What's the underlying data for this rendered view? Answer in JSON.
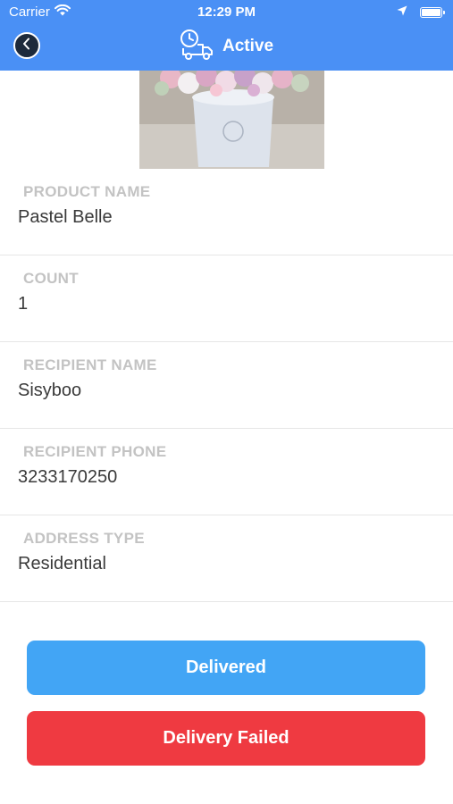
{
  "status_bar": {
    "carrier": "Carrier",
    "time": "12:29 PM"
  },
  "header": {
    "title": "Active",
    "back_icon": "chevron-left-icon",
    "title_icon": "delivery-truck-clock-icon",
    "background_color": "#4a90f5"
  },
  "fields": [
    {
      "label": "PRODUCT NAME",
      "value": "Pastel Belle"
    },
    {
      "label": "COUNT",
      "value": "1"
    },
    {
      "label": "RECIPIENT NAME",
      "value": "Sisyboo"
    },
    {
      "label": "RECIPIENT PHONE",
      "value": "3233170250"
    },
    {
      "label": "ADDRESS TYPE",
      "value": "Residential"
    }
  ],
  "actions": {
    "delivered_label": "Delivered",
    "delivered_color": "#42a5f5",
    "failed_label": "Delivery Failed",
    "failed_color": "#ef3a41"
  }
}
